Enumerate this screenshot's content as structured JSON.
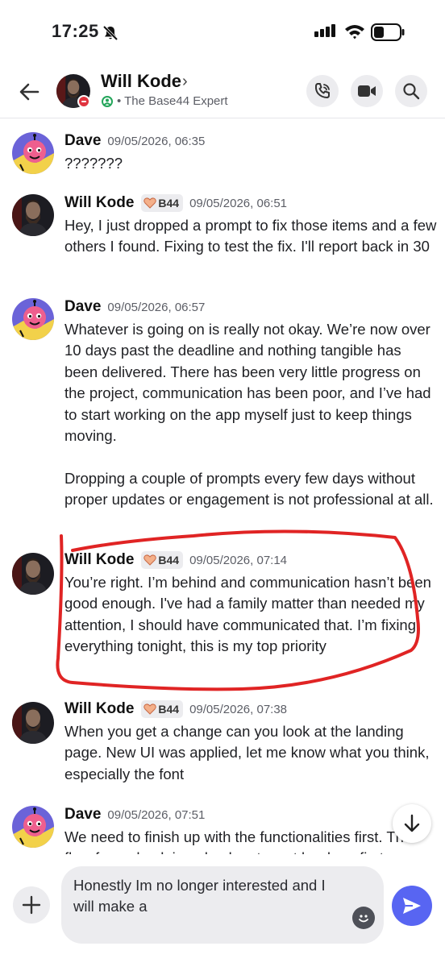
{
  "status_bar": {
    "time": "17:25"
  },
  "header": {
    "name": "Will Kode",
    "chevron": "›",
    "subtitle": "• The Base44 Expert"
  },
  "messages": [
    {
      "author": "Dave",
      "tag": "",
      "time": "09/05/2026, 06:35",
      "text": "???????"
    },
    {
      "author": "Will Kode",
      "tag": "B44",
      "time": "09/05/2026, 06:51",
      "text": "Hey, I just dropped a prompt to fix those items and a few others I found. Fixing to test the fix. I'll report back in 30"
    },
    {
      "author": "Dave",
      "tag": "",
      "time": "09/05/2026, 06:57",
      "text": "Whatever is going on is really not okay. We’re now over 10 days past the deadline and nothing tangible has been delivered. There has been very little progress on the project, communication has been poor, and I’ve had to start working on the app myself just to keep things moving.\n\nDropping a couple of prompts every few days without proper updates or engagement is not professional at all."
    },
    {
      "author": "Will Kode",
      "tag": "B44",
      "time": "09/05/2026, 07:14",
      "text": "You’re right. I’m behind and communication hasn’t been good enough. I've had a family matter than needed my attention, I should have communicated that. I’m fixing everything tonight, this is my top priority"
    },
    {
      "author": "Will Kode",
      "tag": "B44",
      "time": "09/05/2026, 07:38",
      "text": "When you get a change can you look at the landing page. New UI was applied, let me know what you think, especially the font"
    },
    {
      "author": "Dave",
      "tag": "",
      "time": "09/05/2026, 07:51",
      "text": "We need to finish up with the functionalities first. The flow from check in - check out must be done first"
    }
  ],
  "composer": {
    "value": "Honestly Im no longer interested and I will make a"
  },
  "colors": {
    "accent": "#5865f2",
    "annotation_red": "#e02424",
    "dnd_red": "#e0343f",
    "online_green": "#23a55a"
  }
}
